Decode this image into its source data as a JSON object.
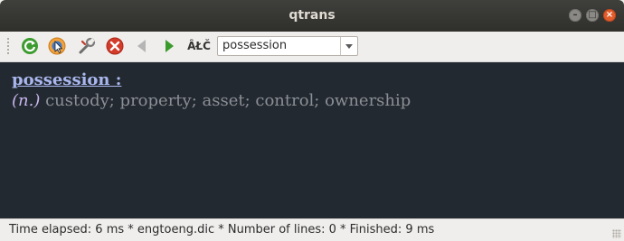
{
  "window": {
    "title": "qtrans"
  },
  "toolbar": {
    "buttons": [
      {
        "name": "refresh",
        "icon": "refresh-icon"
      },
      {
        "name": "pick",
        "icon": "clipboard-pick-icon"
      },
      {
        "name": "settings",
        "icon": "wrench-icon"
      },
      {
        "name": "stop",
        "icon": "stop-icon"
      },
      {
        "name": "back",
        "icon": "back-arrow-icon"
      },
      {
        "name": "forward",
        "icon": "forward-arrow-icon"
      },
      {
        "name": "spell",
        "icon": "spell-check-icon",
        "label": "ȂŁČ"
      }
    ],
    "search": {
      "value": "possession"
    }
  },
  "result": {
    "word": "possession :",
    "pos": "(n.)",
    "definition": "custody; property; asset; control; ownership"
  },
  "status": {
    "text": "Time elapsed: 6 ms  *  engtoeng.dic  *  Number of lines: 0  *  Finished: 9 ms"
  },
  "colors": {
    "titlebar": "#2f2f2c",
    "content_bg": "#232930",
    "word": "#a9b7ee",
    "definition": "#8b8f96",
    "pos": "#c8b6f0",
    "close_button": "#e25d2c"
  }
}
